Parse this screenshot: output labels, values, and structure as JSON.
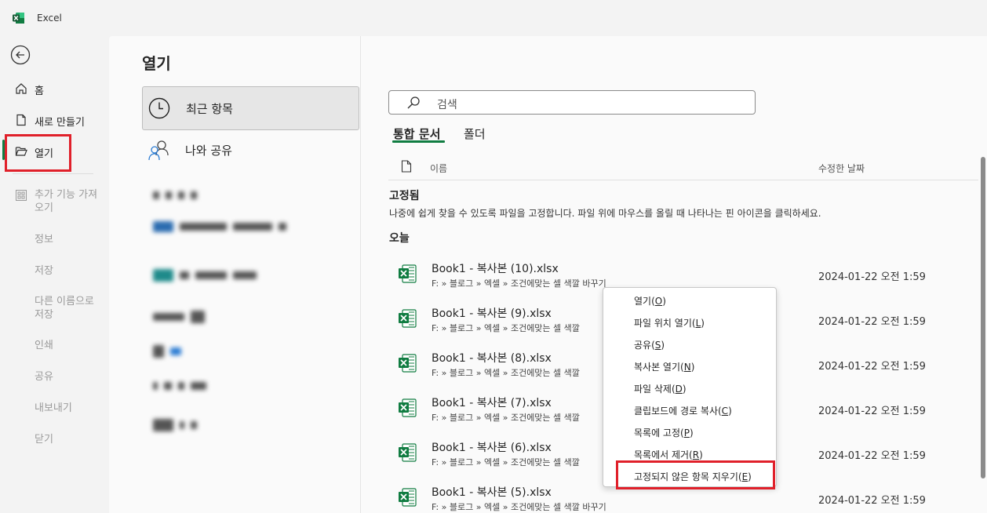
{
  "app": {
    "title": "Excel"
  },
  "nav": {
    "home": "홈",
    "new": "새로 만들기",
    "open": "열기",
    "addins_line1": "추가 기능 가져",
    "addins_line2": "오기",
    "info": "정보",
    "save": "저장",
    "saveas_line1": "다른 이름으로",
    "saveas_line2": "저장",
    "print": "인쇄",
    "share": "공유",
    "export": "내보내기",
    "close": "닫기"
  },
  "page": {
    "title": "열기"
  },
  "locations": {
    "recent": "최근 항목",
    "shared": "나와 공유"
  },
  "search": {
    "placeholder": "검색"
  },
  "tabs": {
    "workbooks": "통합 문서",
    "folders": "폴더"
  },
  "columns": {
    "name": "이름",
    "modified": "수정한 날짜"
  },
  "pinned": {
    "title": "고정됨",
    "note": "나중에 쉽게 찾을 수 있도록 파일을 고정합니다. 파일 위에 마우스를 올릴 때 나타나는 핀 아이콘을 클릭하세요."
  },
  "today": {
    "title": "오늘"
  },
  "files": [
    {
      "name": "Book1 - 복사본 (10).xlsx",
      "path": "F: » 블로그 » 엑셀 » 조건에맞는 셀 색깔 바꾸기",
      "date": "2024-01-22 오전 1:59"
    },
    {
      "name": "Book1 - 복사본 (9).xlsx",
      "path": "F: » 블로그 » 엑셀 » 조건에맞는 셀 색깔",
      "date": "2024-01-22 오전 1:59"
    },
    {
      "name": "Book1 - 복사본 (8).xlsx",
      "path": "F: » 블로그 » 엑셀 » 조건에맞는 셀 색깔",
      "date": "2024-01-22 오전 1:59"
    },
    {
      "name": "Book1 - 복사본 (7).xlsx",
      "path": "F: » 블로그 » 엑셀 » 조건에맞는 셀 색깔",
      "date": "2024-01-22 오전 1:59"
    },
    {
      "name": "Book1 - 복사본 (6).xlsx",
      "path": "F: » 블로그 » 엑셀 » 조건에맞는 셀 색깔",
      "date": "2024-01-22 오전 1:59"
    },
    {
      "name": "Book1 - 복사본 (5).xlsx",
      "path": "F: » 블로그 » 엑셀 » 조건에맞는 셀 색깔 바꾸기",
      "date": "2024-01-22 오전 1:59"
    }
  ],
  "context_menu": [
    {
      "text": "열기(",
      "key": "O",
      "end": ")"
    },
    {
      "text": "파일 위치 열기(",
      "key": "L",
      "end": ")"
    },
    {
      "text": "공유(",
      "key": "S",
      "end": ")"
    },
    {
      "text": "복사본 열기(",
      "key": "N",
      "end": ")"
    },
    {
      "text": "파일 삭제(",
      "key": "D",
      "end": ")"
    },
    {
      "text": "클립보드에 경로 복사(",
      "key": "C",
      "end": ")"
    },
    {
      "text": "목록에 고정(",
      "key": "P",
      "end": ")"
    },
    {
      "text": "목록에서 제거(",
      "key": "R",
      "end": ")"
    },
    {
      "text": "고정되지 않은 항목 지우기(",
      "key": "E",
      "end": ")"
    }
  ],
  "colors": {
    "excel_green": "#107c41",
    "highlight_red": "#e0202a"
  },
  "icons": {
    "back": "back-arrow-icon",
    "home": "home-icon",
    "new": "document-icon",
    "open": "folder-open-icon",
    "addins": "grid-icon",
    "recent": "clock-icon",
    "shared": "people-icon",
    "search": "search-icon",
    "file": "excel-file-icon"
  }
}
